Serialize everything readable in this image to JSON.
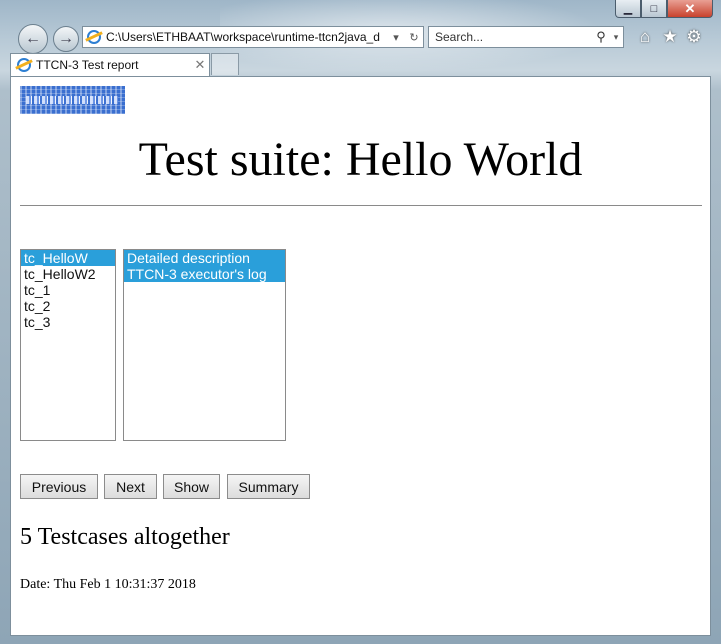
{
  "browser": {
    "address": "C:\\Users\\ETHBAAT\\workspace\\runtime-ttcn2java_d",
    "search_placeholder": "Search...",
    "tab_title": "TTCN-3 Test report",
    "caption": {
      "minimize": "▁",
      "maximize": "□",
      "close": "✕"
    },
    "icons": {
      "back": "←",
      "forward": "→",
      "refresh": "↻",
      "dropdown": "▾",
      "search": "⚲",
      "home": "⌂",
      "favorites": "★",
      "tools": "⚙",
      "tab_close": "✕"
    }
  },
  "page": {
    "title": "Test suite: Hello World",
    "testcases": [
      {
        "label": "tc_HelloW",
        "selected": true
      },
      {
        "label": "tc_HelloW2",
        "selected": false
      },
      {
        "label": "tc_1",
        "selected": false
      },
      {
        "label": "tc_2",
        "selected": false
      },
      {
        "label": "tc_3",
        "selected": false
      }
    ],
    "details": [
      {
        "label": "Detailed description",
        "selected": true
      },
      {
        "label": "TTCN-3 executor's log",
        "selected": true
      }
    ],
    "buttons": {
      "previous": "Previous",
      "next": "Next",
      "show": "Show",
      "summary": "Summary"
    },
    "count_text": "5 Testcases altogether",
    "date_text": "Date: Thu Feb 1 10:31:37 2018"
  },
  "colors": {
    "selection": "#2a9fda",
    "logo": "#3a6fd0"
  }
}
